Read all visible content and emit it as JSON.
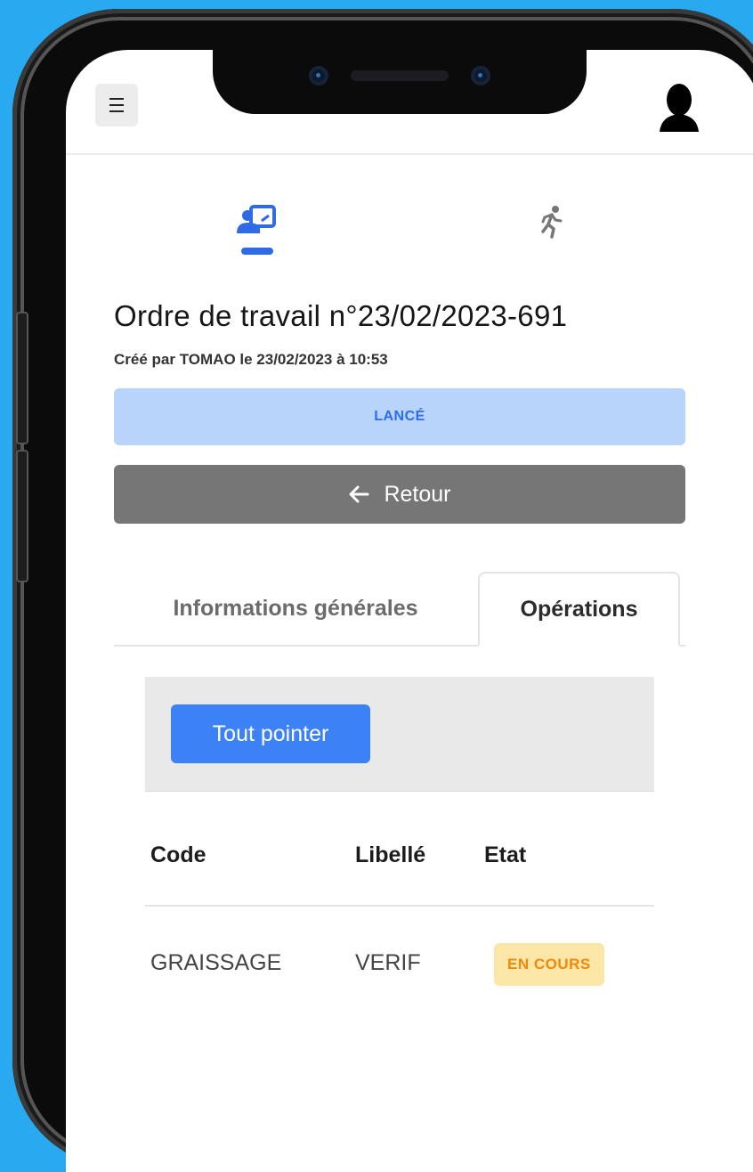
{
  "header": {
    "menu_icon": "hamburger-menu-icon",
    "avatar_icon": "user-avatar-icon"
  },
  "nav_icons": [
    {
      "name": "presentation-user-icon",
      "active": true
    },
    {
      "name": "running-person-icon",
      "active": false
    }
  ],
  "order": {
    "title": "Ordre de travail n°23/02/2023-691",
    "subtitle": "Créé par TOMAO le 23/02/2023 à 10:53",
    "status": "LANCÉ",
    "back_label": "Retour"
  },
  "tabs": [
    {
      "label": "Informations générales",
      "active": false
    },
    {
      "label": "Opérations",
      "active": true
    }
  ],
  "operations": {
    "tout_pointer_label": "Tout pointer",
    "columns": [
      "Code",
      "Libellé",
      "Etat"
    ],
    "rows": [
      {
        "code": "GRAISSAGE",
        "libelle": "VERIF",
        "etat": "EN COURS"
      }
    ]
  },
  "colors": {
    "background": "#29a9f0",
    "primary": "#3c82f6",
    "status_bg": "#b9d4fb",
    "back_button": "#767676",
    "badge_bg": "#fde7a8",
    "badge_text": "#f0890a"
  }
}
